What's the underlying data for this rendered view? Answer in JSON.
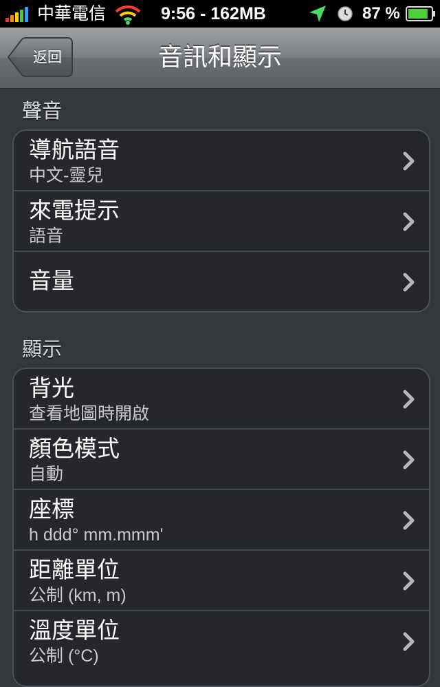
{
  "status_bar": {
    "carrier": "中華電信",
    "time": "9:56 - 162MB",
    "battery_percent": "87 %",
    "battery_level": 0.87,
    "icons": [
      "signal-bars-icon",
      "wifi-icon",
      "location-arrow-icon",
      "alarm-clock-icon",
      "battery-icon"
    ]
  },
  "nav": {
    "back_label": "返回",
    "title": "音訊和顯示"
  },
  "sections": [
    {
      "header": "聲音",
      "rows": [
        {
          "title": "導航語音",
          "subtitle": "中文-靈兒"
        },
        {
          "title": "來電提示",
          "subtitle": "語音"
        },
        {
          "title": "音量",
          "subtitle": ""
        }
      ]
    },
    {
      "header": "顯示",
      "rows": [
        {
          "title": "背光",
          "subtitle": "查看地圖時開啟"
        },
        {
          "title": "顏色模式",
          "subtitle": "自動"
        },
        {
          "title": "座標",
          "subtitle": "h ddd° mm.mmm'"
        },
        {
          "title": "距離單位",
          "subtitle": "公制 (km, m)"
        },
        {
          "title": "溫度單位",
          "subtitle": "公制 (°C)"
        }
      ]
    }
  ],
  "colors": {
    "background": "#34373c",
    "group_background": "#25272b",
    "battery_green": "#4cd13b"
  }
}
